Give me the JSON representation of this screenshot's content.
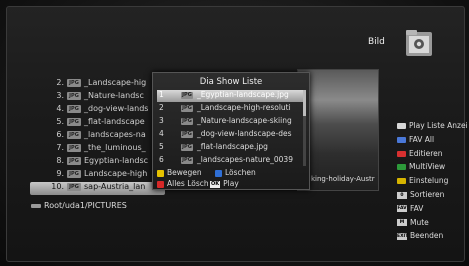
{
  "header": {
    "title": "Bild",
    "folder_icon": "folder-image-icon"
  },
  "filelist": {
    "rows": [
      {
        "num": "2.",
        "label": "_Landscape-hig"
      },
      {
        "num": "3.",
        "label": "_Nature-landsc"
      },
      {
        "num": "4.",
        "label": "_dog-view-lands"
      },
      {
        "num": "5.",
        "label": "_flat-landscape"
      },
      {
        "num": "6.",
        "label": "_landscapes-na"
      },
      {
        "num": "7.",
        "label": "_the_luminous_"
      },
      {
        "num": "8.",
        "label": "Egyptian-landsc"
      },
      {
        "num": "9.",
        "label": "Landscape-high"
      },
      {
        "num": "10.",
        "label": "sap-Austria_lan"
      }
    ],
    "badge": "JPG",
    "path": "Root/uda1/PICTURES"
  },
  "thumbnail": {
    "caption": "king-holiday-Austr"
  },
  "dialog": {
    "title": "Dia Show Liste",
    "rows": [
      {
        "num": "1",
        "label": "_Egyptian-landscape.jpg"
      },
      {
        "num": "2",
        "label": "_Landscape-high-resoluti"
      },
      {
        "num": "3",
        "label": "_Nature-landscape-skiing"
      },
      {
        "num": "4",
        "label": "_dog-view-landscape-des"
      },
      {
        "num": "5",
        "label": "_flat-landscape.jpg"
      },
      {
        "num": "6",
        "label": "_landscapes-nature_0039"
      }
    ],
    "actions": {
      "move": "Bewegen",
      "delete": "Löschen",
      "delete_all": "Alles Lösch",
      "ok_key": "OK",
      "play": "Play"
    },
    "colors": {
      "yellow": "#e6c200",
      "blue": "#2f6fd6",
      "red": "#d62828"
    }
  },
  "menu": {
    "items": [
      {
        "label": "Play Liste Anzei",
        "icon": "#d8d8d8",
        "type": "color"
      },
      {
        "label": "FAV All",
        "icon": "#4a78d8",
        "type": "color"
      },
      {
        "label": "Editieren",
        "icon": "#d83030",
        "type": "color"
      },
      {
        "label": "MultiView",
        "icon": "#2d9a3a",
        "type": "color"
      },
      {
        "label": "Einstelung",
        "icon": "#d6b400",
        "type": "color"
      },
      {
        "label": "Sortieren",
        "key": "0",
        "type": "key"
      },
      {
        "label": "FAV",
        "key": "FAV",
        "type": "key"
      },
      {
        "label": "Mute",
        "key": "M",
        "type": "key"
      },
      {
        "label": "Beenden",
        "key": "EXIT",
        "type": "key"
      }
    ]
  }
}
